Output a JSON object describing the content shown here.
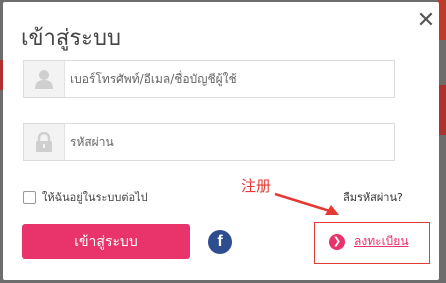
{
  "modal": {
    "title": "เข้าสู่ระบบ",
    "close_glyph": "✕"
  },
  "form": {
    "username_placeholder": "เบอร์โทรศัพท์/อีเมล/ชื่อบัญชีผู้ใช้",
    "password_placeholder": "รหัสผ่าน",
    "remember_label": "ให้ฉันอยู่ในระบบต่อไป",
    "forgot_label": "ลืมรหัสผ่าน?",
    "login_label": "เข้าสู่ระบบ"
  },
  "social": {
    "facebook_glyph": "f"
  },
  "register": {
    "label": "ลงทะเบียน",
    "icon_glyph": "❯"
  },
  "annotation": {
    "text": "注册"
  },
  "colors": {
    "accent": "#e8336b",
    "annotation": "#e53935",
    "facebook": "#2d4d8e"
  }
}
